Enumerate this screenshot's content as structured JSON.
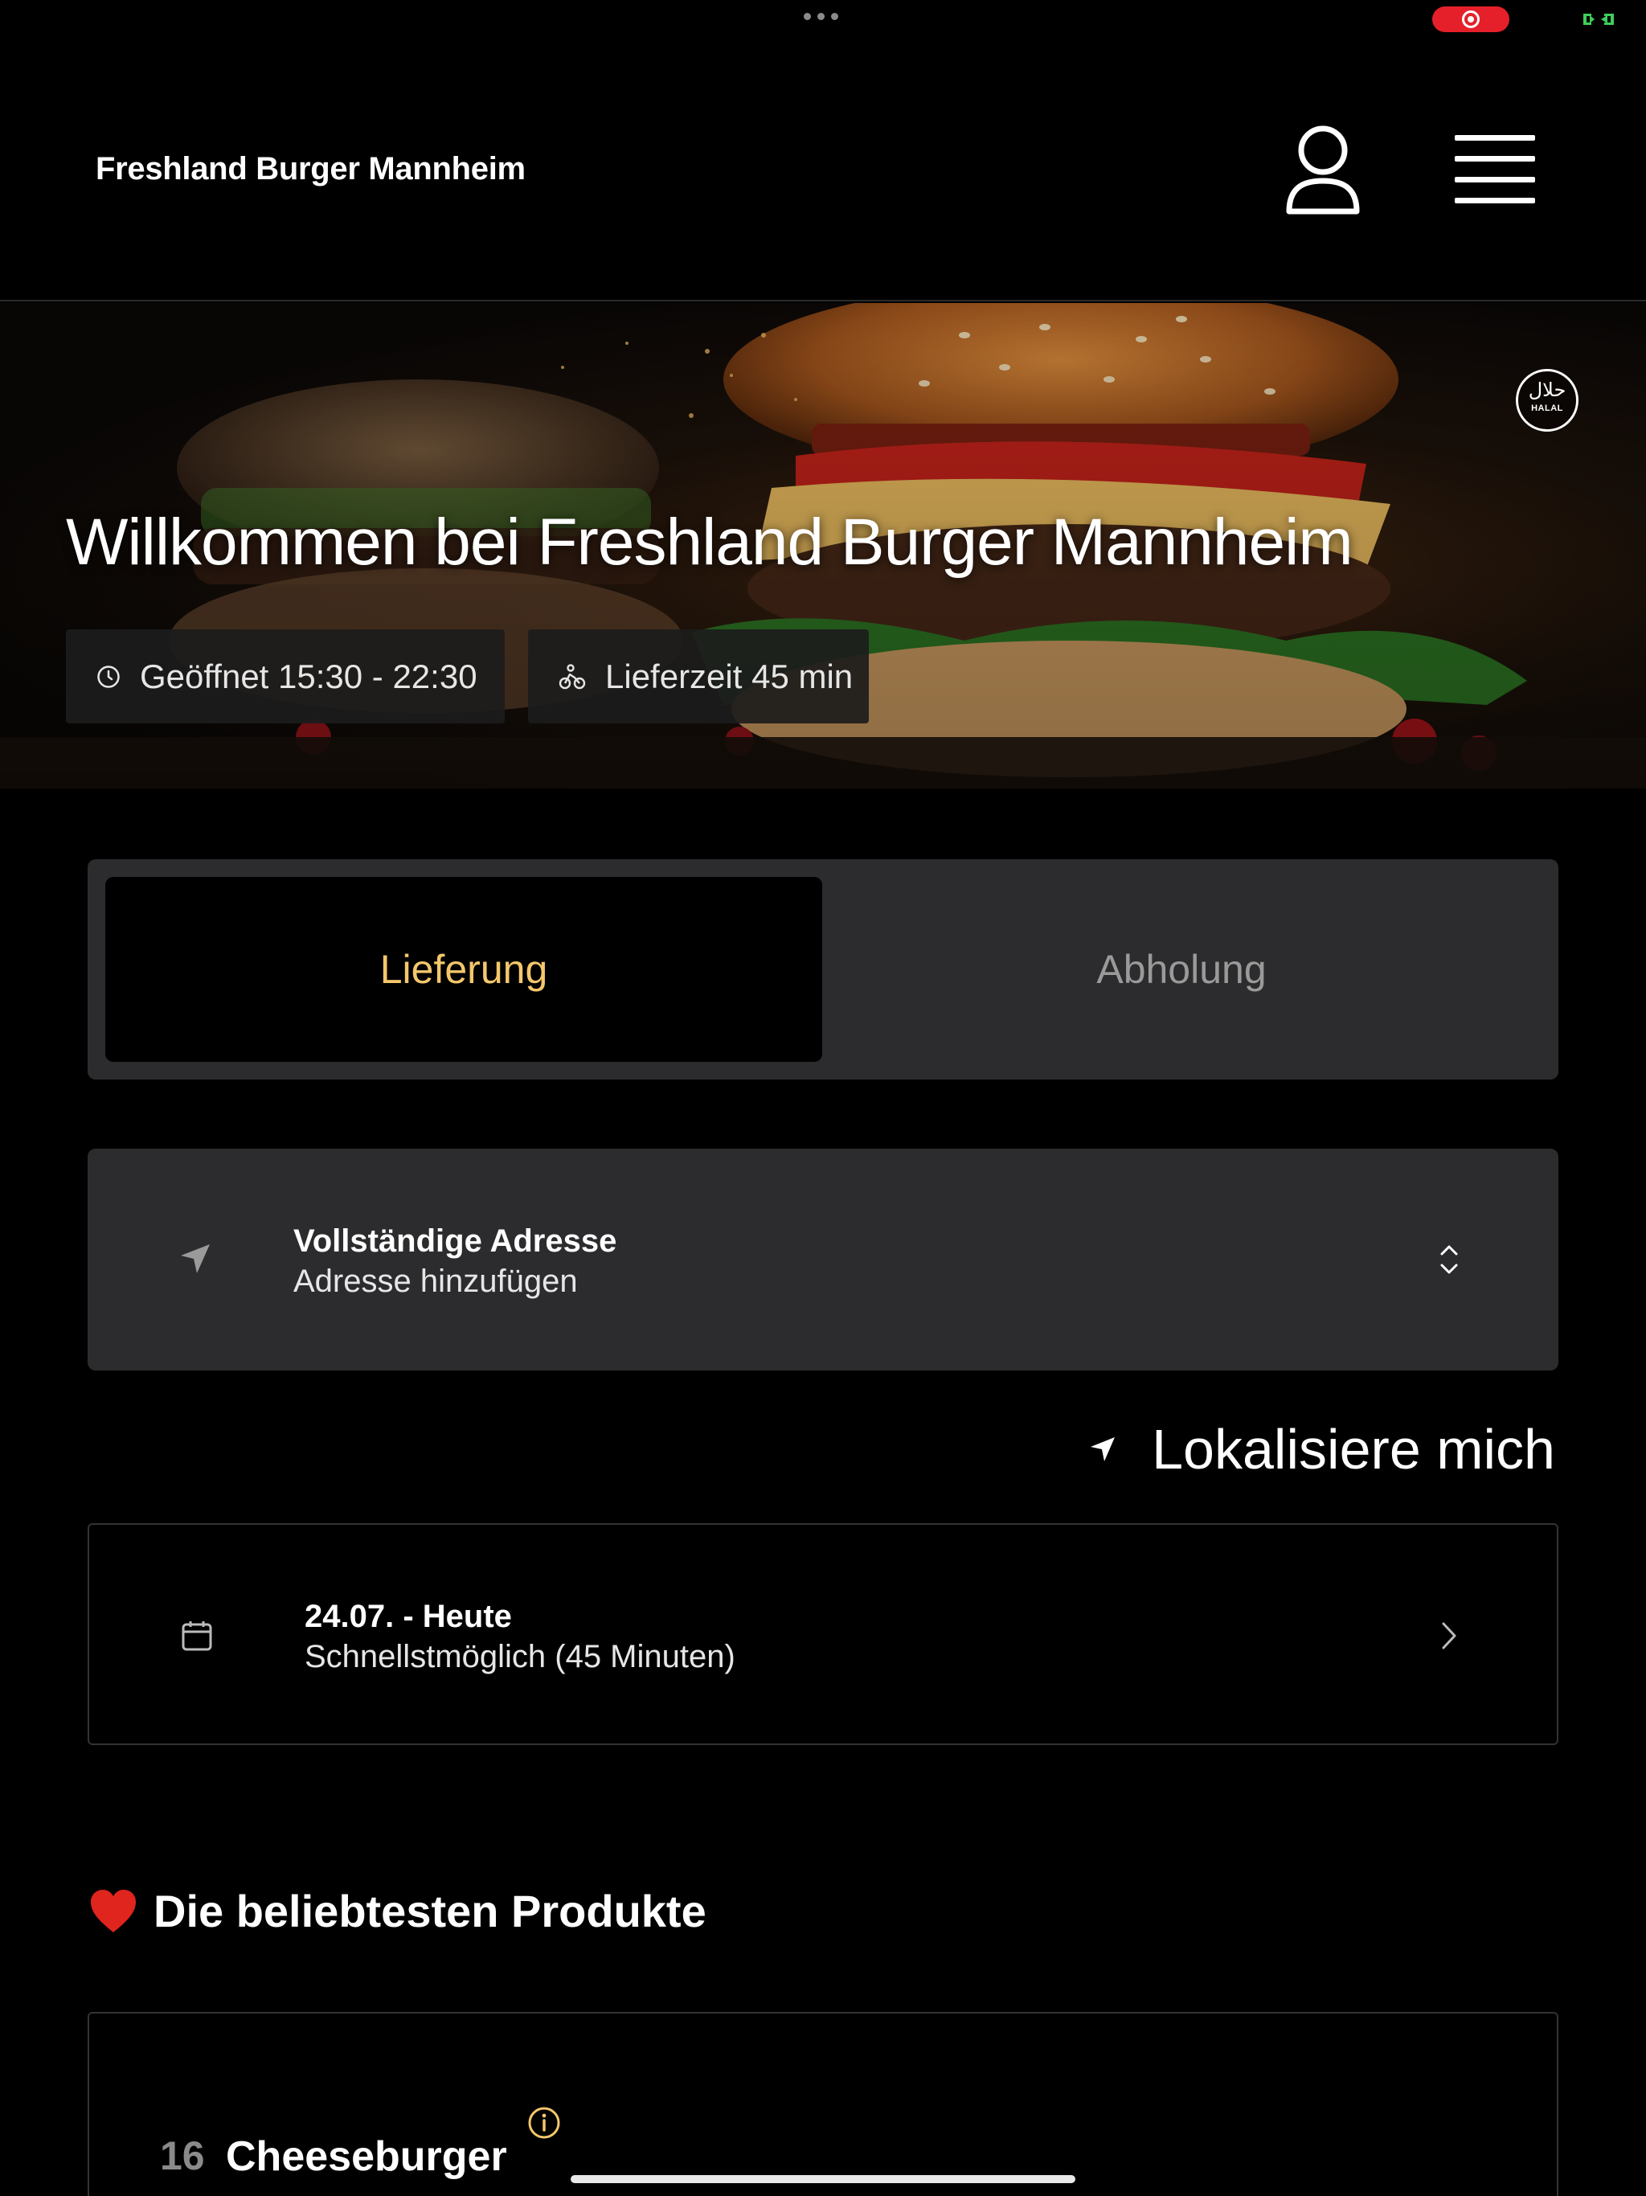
{
  "header": {
    "brand": "Freshland Burger Mannheim",
    "user_icon": "user-icon",
    "menu_icon": "hamburger-menu-icon"
  },
  "hero": {
    "title": "Willkommen bei Freshland Burger Mannheim",
    "badge_ar": "حلال",
    "badge_en": "HALAL",
    "opening_hours": "Geöffnet 15:30 - 22:30",
    "delivery_time": "Lieferzeit 45 min"
  },
  "order_mode": {
    "tabs": [
      "Lieferung",
      "Abholung"
    ],
    "selected": "Lieferung",
    "active_color": "#f4c76b"
  },
  "address": {
    "title": "Vollständige Adresse",
    "value": "Adresse hinzufügen"
  },
  "locate": {
    "label": "Lokalisiere mich"
  },
  "schedule": {
    "date": "24.07. - Heute",
    "time": "Schnellstmöglich (45 Minuten)"
  },
  "popular": {
    "title": "Die beliebtesten Produkte",
    "items": [
      {
        "number": "16",
        "name": "Cheeseburger"
      }
    ]
  },
  "colors": {
    "background": "#000000",
    "card": "#2c2c2e",
    "accent": "#f4c76b",
    "record": "#e5202a"
  }
}
